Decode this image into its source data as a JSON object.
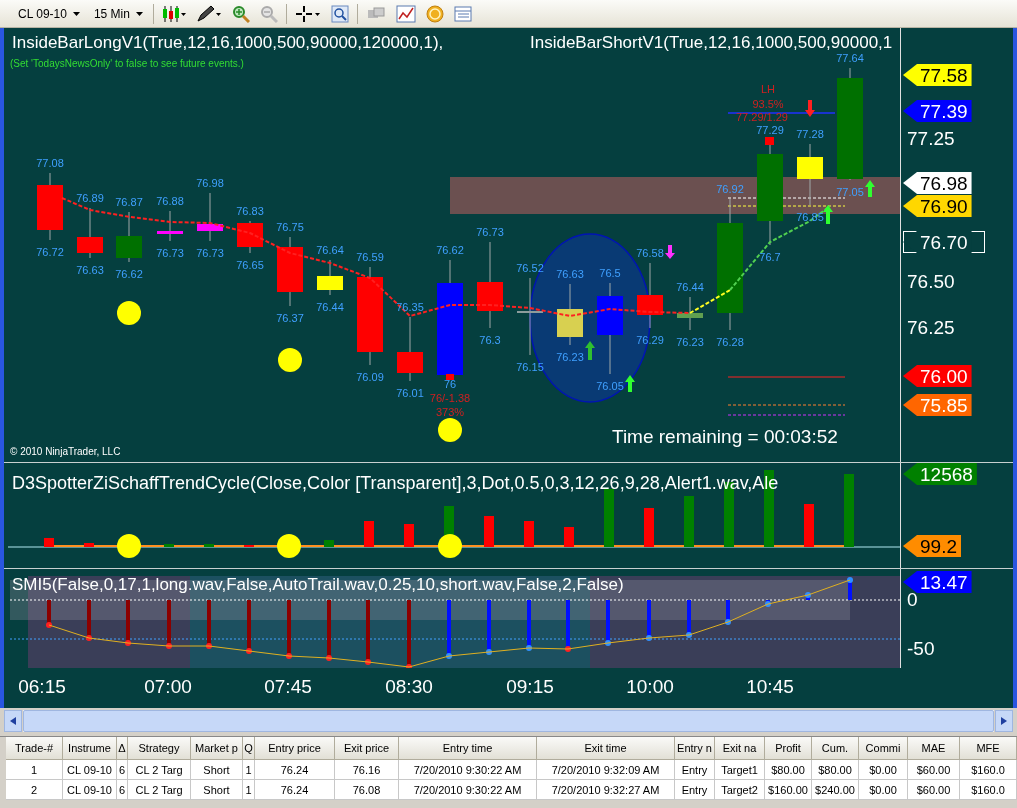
{
  "toolbar": {
    "instrument": "CL 09-10",
    "interval": "15 Min"
  },
  "main_pane": {
    "titles": [
      "InsideBarLongV1(True,12,16,1000,500,90000,120000,1),",
      "InsideBarShortV1(True,12,16,1000,500,90000,1"
    ],
    "note": "(Set 'TodaysNewsOnly' to false to see future events.)",
    "candles": [
      {
        "color": "#ff0000",
        "high": "77.08",
        "low": "76.72"
      },
      {
        "color": "#ff0000",
        "high": "76.89",
        "low": "76.63"
      },
      {
        "color": "#007000",
        "high": "76.87",
        "low": "76.62"
      },
      {
        "color": "#ff00ff",
        "high": "76.88",
        "low": "76.73"
      },
      {
        "color": "#ff00ff",
        "high": "76.98",
        "low": "76.73"
      },
      {
        "color": "#ff0000",
        "high": "76.83",
        "low": "76.65"
      },
      {
        "color": "#ff0000",
        "high": "76.75",
        "low": "76.37"
      },
      {
        "color": "#ffff00",
        "high": "76.64",
        "low": "76.44"
      },
      {
        "color": "#ff0000",
        "high": "76.59",
        "low": "76.09"
      },
      {
        "color": "#ff0000",
        "high": "76.35",
        "low": "76.01"
      },
      {
        "color": "#0000ff",
        "high": "76.62",
        "low": "76"
      },
      {
        "color": "#ff0000",
        "high": "76.73",
        "low": "76.3"
      },
      {
        "color": "#8c9c9c",
        "high": "76.52",
        "low": "76.15"
      },
      {
        "color": "#d8d050",
        "high": "76.63",
        "low": "76.23"
      },
      {
        "color": "#0000ff",
        "high": "76.5",
        "low": "76.05"
      },
      {
        "color": "#ff0000",
        "high": "76.58",
        "low": "76.29"
      },
      {
        "color": "#60a050",
        "high": "76.44",
        "low": "76.23"
      },
      {
        "color": "#007000",
        "high": "76.92",
        "low": "76.28"
      },
      {
        "color": "#007000",
        "high": "77.29",
        "low": "76.7"
      },
      {
        "color": "#ffff00",
        "high": "77.28",
        "low": "76.85"
      },
      {
        "color": "#007000",
        "high": "77.64",
        "low": "77.05"
      }
    ],
    "annotations": [
      "LH",
      "93.5%",
      "77.29/1.29",
      "76/-1.38",
      "373%"
    ],
    "time_remaining": "Time remaining = 00:03:52",
    "copyright": "© 2010 NinjaTrader, LLC",
    "price_ticks": [
      "77.25",
      "76.50",
      "76.25"
    ],
    "price_tags": [
      {
        "text": "77.58",
        "color": "#ffff00"
      },
      {
        "text": "77.39",
        "color": "#0000ff"
      },
      {
        "text": "76.98",
        "color": "#ffffff"
      },
      {
        "text": "76.90",
        "color": "#ffd700"
      },
      {
        "text": "76.70",
        "color": "#053f3f"
      },
      {
        "text": "76.00",
        "color": "#ff0000"
      },
      {
        "text": "75.85",
        "color": "#ff6600"
      }
    ]
  },
  "schaff_pane": {
    "title": "D3SpotterZiSchaffTrendCycle(Close,Color  [Transparent],3,Dot,0.5,0,3,12,26,9,28,Alert1.wav,Ale",
    "tags": [
      {
        "text": "12568",
        "color": "#008000"
      },
      {
        "text": "99.2",
        "color": "#ff8c00"
      }
    ]
  },
  "smi_pane": {
    "title": "SMI5(False,0,17,1,long.wav,False,AutoTrail.wav,0.25,10,short.wav,False,2,False)",
    "ticks": [
      "0",
      "-50"
    ],
    "tags": [
      {
        "text": "13.47",
        "color": "#0000ff"
      }
    ]
  },
  "time_axis": [
    "06:15",
    "07:00",
    "07:45",
    "08:30",
    "09:15",
    "10:00",
    "10:45"
  ],
  "trades_table": {
    "columns": [
      "Trade-#",
      "Instrume",
      "Δ",
      "Strategy",
      "Market p",
      "Q",
      "Entry price",
      "Exit price",
      "Entry time",
      "Exit time",
      "Entry n",
      "Exit na",
      "Profit",
      "Cum.",
      "Commi",
      "MAE",
      "MFE"
    ],
    "rows": [
      [
        "1",
        "CL 09-10",
        "6",
        "CL 2 Targ",
        "Short",
        "1",
        "76.24",
        "76.16",
        "7/20/2010 9:30:22 AM",
        "7/20/2010 9:32:09 AM",
        "Entry",
        "Target1",
        "$80.00",
        "$80.00",
        "$0.00",
        "$60.00",
        "$160.0"
      ],
      [
        "2",
        "CL 09-10",
        "6",
        "CL 2 Targ",
        "Short",
        "1",
        "76.24",
        "76.08",
        "7/20/2010 9:30:22 AM",
        "7/20/2010 9:32:27 AM",
        "Entry",
        "Target2",
        "$160.00",
        "$240.00",
        "$0.00",
        "$60.00",
        "$160.0"
      ]
    ]
  }
}
